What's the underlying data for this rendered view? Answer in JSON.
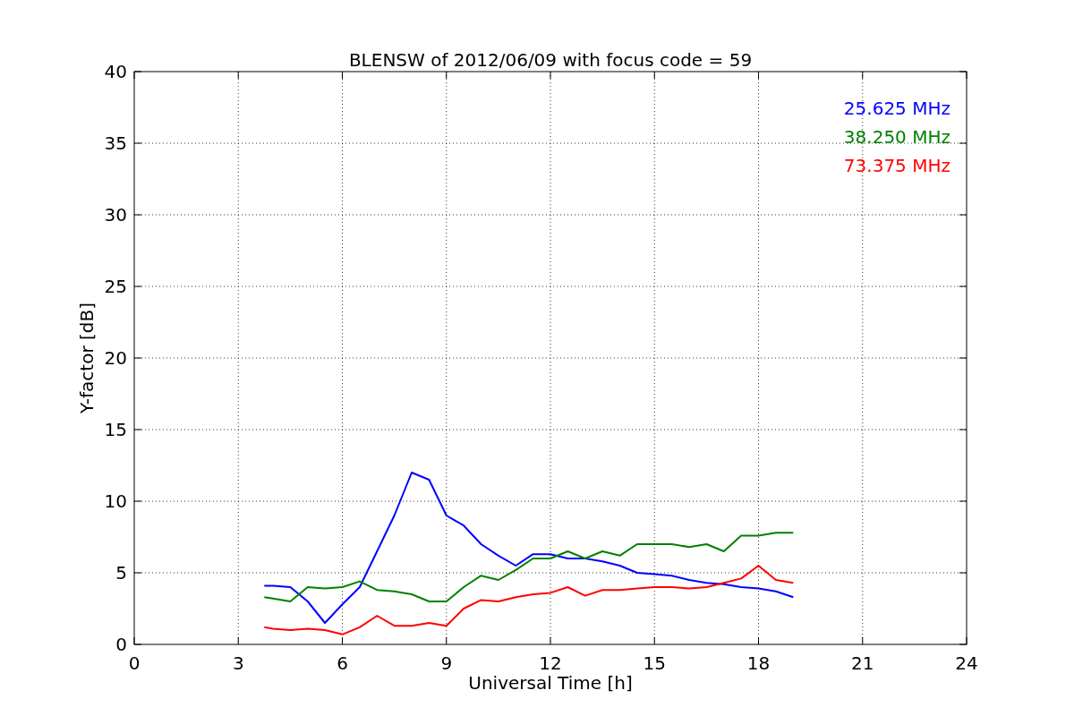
{
  "chart_data": {
    "type": "line",
    "title": "BLENSW of 2012/06/09 with focus code = 59",
    "xlabel": "Universal Time [h]",
    "ylabel": "Y-factor [dB]",
    "x": [
      3.75,
      4,
      4.5,
      5,
      5.5,
      6,
      6.5,
      7,
      7.5,
      8,
      8.5,
      9,
      9.5,
      10,
      10.5,
      11,
      11.5,
      12,
      12.5,
      13,
      13.5,
      14,
      14.5,
      15,
      15.5,
      16,
      16.5,
      17,
      17.5,
      18,
      18.5,
      19
    ],
    "series": [
      {
        "name": "25.625 MHz",
        "color": "#0000ff",
        "values": [
          4.1,
          4.1,
          4.0,
          3.0,
          1.5,
          2.8,
          4.0,
          6.5,
          9,
          12,
          11.5,
          9,
          8.3,
          7,
          6.2,
          5.5,
          6.3,
          6.3,
          6,
          6,
          5.8,
          5.5,
          5.0,
          4.9,
          4.8,
          4.5,
          4.3,
          4.2,
          4.0,
          3.9,
          3.7,
          3.3
        ]
      },
      {
        "name": "38.250 MHz",
        "color": "#008000",
        "values": [
          3.3,
          3.2,
          3.0,
          4.0,
          3.9,
          4.0,
          4.4,
          3.8,
          3.7,
          3.5,
          3.0,
          3.0,
          4.0,
          4.8,
          4.5,
          5.2,
          6.0,
          6.0,
          6.5,
          6.0,
          6.5,
          6.2,
          7.0,
          7.0,
          7.0,
          6.8,
          7.0,
          6.5,
          7.6,
          7.6,
          7.8,
          7.8
        ]
      },
      {
        "name": "73.375 MHz",
        "color": "#ff0000",
        "values": [
          1.2,
          1.1,
          1.0,
          1.1,
          1.0,
          0.7,
          1.2,
          2.0,
          1.3,
          1.3,
          1.5,
          1.3,
          2.5,
          3.1,
          3.0,
          3.3,
          3.5,
          3.6,
          4.0,
          3.4,
          3.8,
          3.8,
          3.9,
          4.0,
          4.0,
          3.9,
          4.0,
          4.3,
          4.6,
          5.5,
          4.5,
          4.3
        ]
      }
    ],
    "xlim": [
      0,
      24
    ],
    "ylim": [
      0,
      40
    ],
    "xticks": [
      0,
      3,
      6,
      9,
      12,
      15,
      18,
      21,
      24
    ],
    "yticks": [
      0,
      5,
      10,
      15,
      20,
      25,
      30,
      35,
      40
    ],
    "grid": true
  }
}
